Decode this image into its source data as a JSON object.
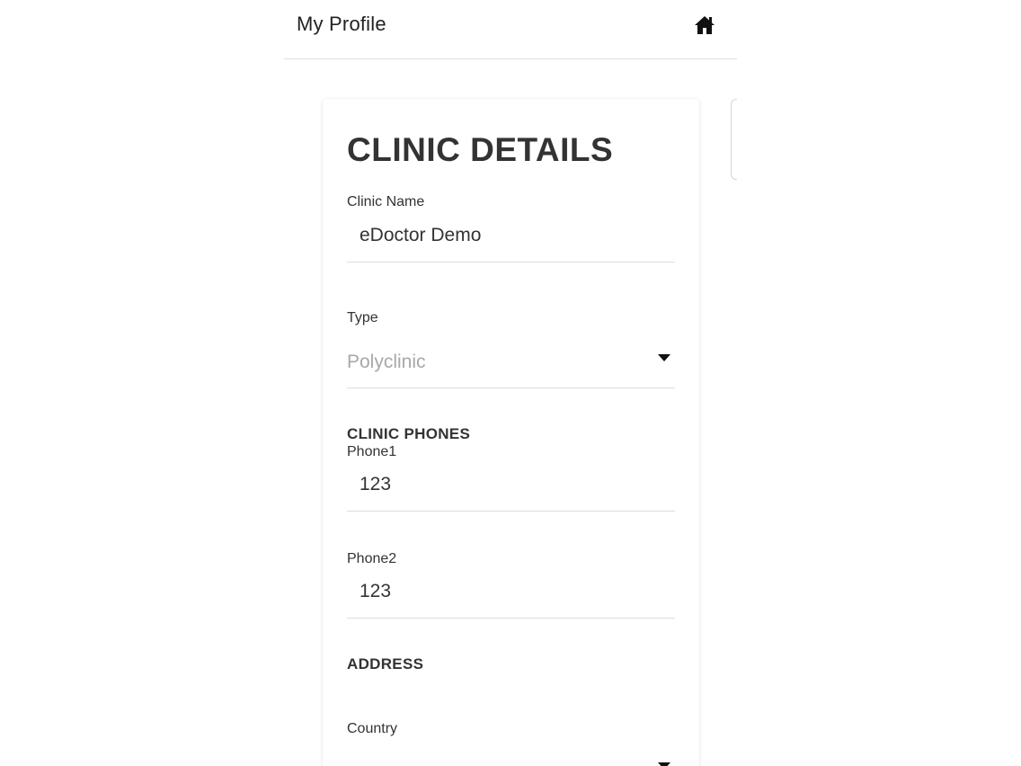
{
  "header": {
    "title": "My Profile",
    "home_icon": "home-icon"
  },
  "card": {
    "title": "CLINIC DETAILS",
    "clinic_name": {
      "label": "Clinic Name",
      "value": "eDoctor Demo"
    },
    "type": {
      "label": "Type",
      "selected": "Polyclinic"
    },
    "phones_section": "CLINIC PHONES",
    "phone1": {
      "label": "Phone1",
      "value": "123"
    },
    "phone2": {
      "label": "Phone2",
      "value": "123"
    },
    "address_section": "ADDRESS",
    "country": {
      "label": "Country"
    }
  },
  "colors": {
    "text": "#333333",
    "placeholder": "#a8a8a8",
    "divider": "#dcdcdc"
  }
}
